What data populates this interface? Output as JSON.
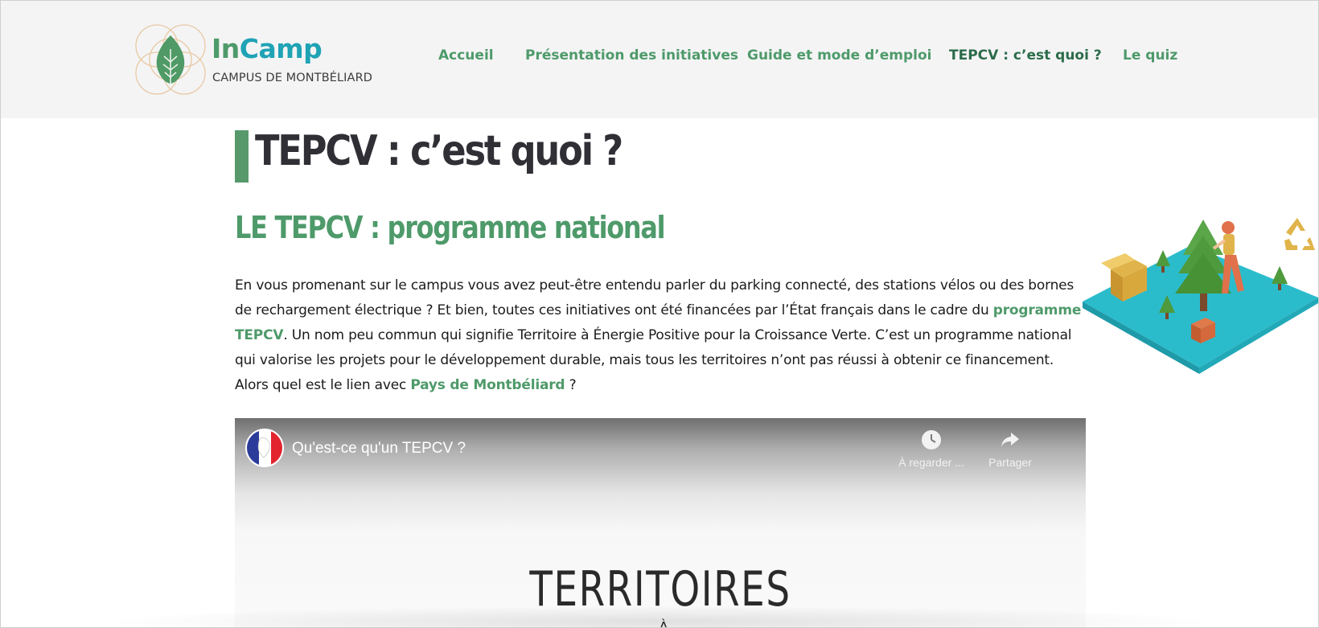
{
  "header": {
    "logo": {
      "in": "In",
      "camp": "Camp",
      "subtitle": "CAMPUS DE MONTBÉLIARD"
    },
    "nav": [
      {
        "label": "Accueil",
        "active": false
      },
      {
        "label": "Présentation des initiatives",
        "active": false
      },
      {
        "label": "Guide et mode d’emploi",
        "active": false
      },
      {
        "label": "TEPCV : c’est quoi ?",
        "active": true
      },
      {
        "label": "Le quiz",
        "active": false
      }
    ]
  },
  "main": {
    "page_title": "TEPCV : c’est quoi ?",
    "section_title": "LE TEPCV : programme national",
    "paragraph": {
      "part1": "En vous promenant sur le campus vous avez peut-être entendu parler du parking connecté, des stations vélos ou des bornes de rechargement électrique ? Et bien, toutes ces initiatives ont été financées par l’État français dans le cadre du ",
      "link1": "programme TEPCV",
      "part2": ". Un nom peu commun qui signifie Territoire à Énergie Positive pour la Croissance Verte. C’est un programme national qui valorise les projets pour le développement durable, mais tous les territoires n’ont pas réussi à obtenir ce financement. Alors quel est le lien avec ",
      "link2": "Pays de Montbéliard",
      "part3": " ?"
    },
    "video": {
      "title": "Qu'est-ce qu'un TEPCV ?",
      "watch_later": "À regarder ...",
      "share": "Partager",
      "frame_text": "TERRITOIRES",
      "frame_text_2": "À"
    }
  },
  "colors": {
    "brand_green": "#4e9a6a",
    "brand_teal": "#1fa3b5",
    "header_bg": "#f4f4f5",
    "title_bar": "#57996b"
  }
}
